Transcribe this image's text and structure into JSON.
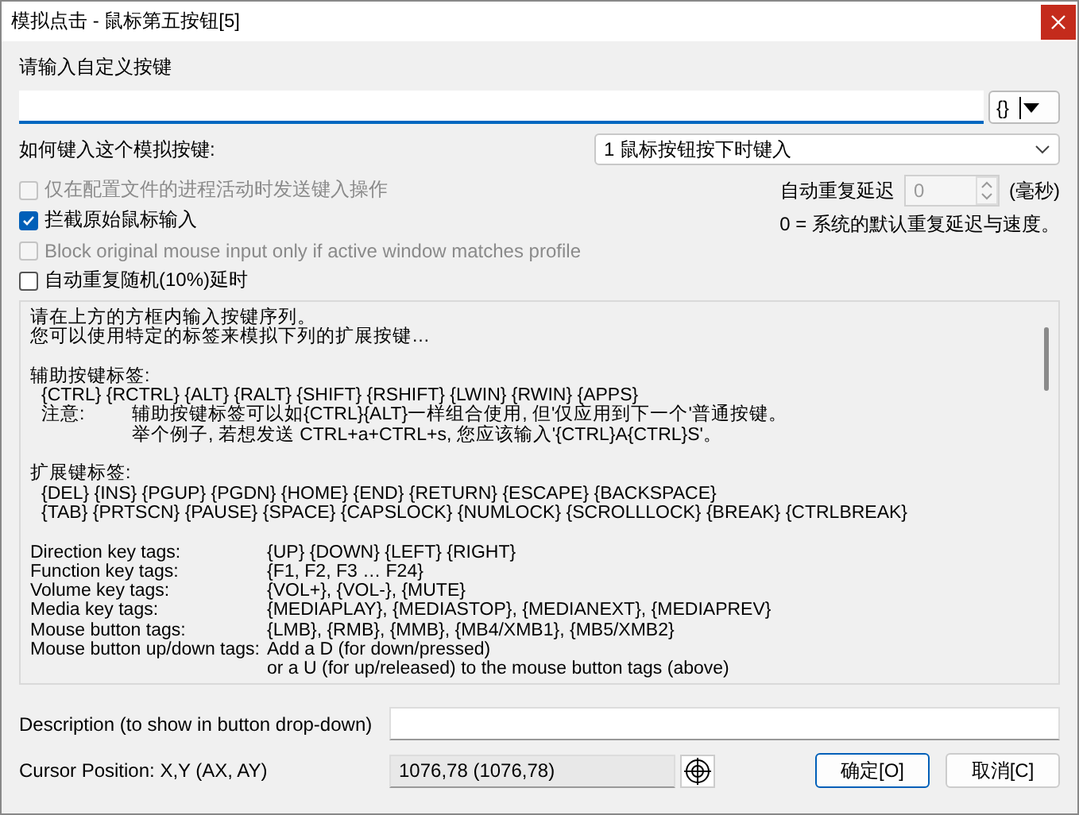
{
  "window": {
    "title": "模拟点击 - 鼠标第五按钮[5]"
  },
  "custom_key": {
    "label": "请输入自定义按键",
    "tag_button": "{}"
  },
  "type_mode": {
    "label": "如何键入这个模拟按键:",
    "value": "1 鼠标按钮按下时键入"
  },
  "options": [
    {
      "label": "仅在配置文件的进程活动时发送键入操作",
      "checked": false,
      "disabled": true
    },
    {
      "label": "拦截原始鼠标输入",
      "checked": true,
      "disabled": false
    },
    {
      "label": "Block original mouse input only if active window matches profile",
      "checked": false,
      "disabled": true
    },
    {
      "label": "自动重复随机(10%)延时",
      "checked": false,
      "disabled": false
    }
  ],
  "repeat_delay": {
    "label": "自动重复延迟",
    "value": "0",
    "unit": "(毫秒)",
    "disabled": true,
    "note": "0 = 系统的默认重复延迟与速度。"
  },
  "help": {
    "lines": [
      {
        "kind": "text",
        "text": "请在上方的方框内输入按键序列。"
      },
      {
        "kind": "text",
        "text": "您可以使用特定的标签来模拟下列的扩展按键…"
      },
      {
        "kind": "blank"
      },
      {
        "kind": "text",
        "text": "辅助按键标签:"
      },
      {
        "kind": "indent",
        "text": "{CTRL} {RCTRL} {ALT} {RALT} {SHIFT} {RSHIFT} {LWIN} {RWIN} {APPS}"
      },
      {
        "kind": "note",
        "label": "注意:",
        "text": "辅助按键标签可以如{CTRL}{ALT}一样组合使用, 但'仅应用到下一个'普通按键。"
      },
      {
        "kind": "note",
        "text": "举个例子, 若想发送 CTRL+a+CTRL+s, 您应该输入'{CTRL}A{CTRL}S'。"
      },
      {
        "kind": "blank"
      },
      {
        "kind": "text",
        "text": "扩展键标签:"
      },
      {
        "kind": "indent",
        "text": "{DEL} {INS} {PGUP} {PGDN} {HOME} {END} {RETURN} {ESCAPE} {BACKSPACE}"
      },
      {
        "kind": "indent",
        "text": "{TAB} {PRTSCN} {PAUSE} {SPACE} {CAPSLOCK} {NUMLOCK} {SCROLLLOCK} {BREAK} {CTRLBREAK}"
      },
      {
        "kind": "blank"
      },
      {
        "kind": "pair",
        "label": "Direction key tags:",
        "text": "{UP} {DOWN} {LEFT} {RIGHT}"
      },
      {
        "kind": "pair",
        "label": "Function key tags:",
        "text": "{F1, F2, F3 … F24}"
      },
      {
        "kind": "pair",
        "label": "Volume key tags:",
        "text": "{VOL+}, {VOL-}, {MUTE}"
      },
      {
        "kind": "pair",
        "label": "Media key tags:",
        "text": "{MEDIAPLAY}, {MEDIASTOP}, {MEDIANEXT}, {MEDIAPREV}"
      },
      {
        "kind": "pair",
        "label": "Mouse button tags:",
        "text": "{LMB}, {RMB}, {MMB}, {MB4/XMB1}, {MB5/XMB2}"
      },
      {
        "kind": "pair",
        "label": "Mouse button up/down tags:",
        "text": "Add a D (for down/pressed)"
      },
      {
        "kind": "pair",
        "text": "or a U (for up/released) to the mouse button tags (above)"
      }
    ]
  },
  "description": {
    "label": "Description (to show in button drop-down)"
  },
  "cursor": {
    "label": "Cursor Position: X,Y (AX, AY)",
    "value": "1076,78 (1076,78)"
  },
  "buttons": [
    {
      "label": "确定[O]",
      "default": true
    },
    {
      "label": "取消[C]",
      "default": false
    }
  ]
}
